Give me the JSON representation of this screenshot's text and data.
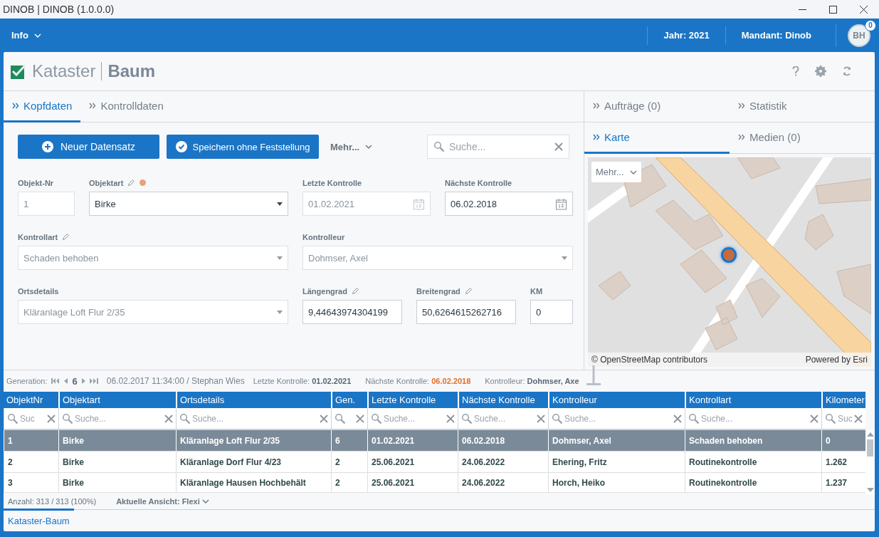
{
  "window": {
    "title": "DINOB | DINOB (1.0.0.0)"
  },
  "header": {
    "menu": "Info",
    "year": "Jahr: 2021",
    "client": "Mandant: Dinob",
    "avatar": "BH",
    "badge": "0"
  },
  "page": {
    "title": "Kataster",
    "subtitle": "Baum"
  },
  "left_tabs": [
    {
      "label": "Kopfdaten",
      "selected": true
    },
    {
      "label": "Kontrolldaten",
      "selected": false
    }
  ],
  "toolbar": {
    "buttons": [
      {
        "label": "Neuer Datensatz",
        "kind": "add"
      },
      {
        "label": "Speichern ohne Feststellung",
        "kind": "save"
      }
    ],
    "more": "Mehr...",
    "search": {
      "placeholder": "Suche..."
    }
  },
  "form": {
    "fields": [
      {
        "label": "Objekt-Nr",
        "kind": "text",
        "value": "1",
        "disabled": true,
        "editable": false
      },
      {
        "label": "Objektart",
        "kind": "select",
        "value": "Birke",
        "disabled": false,
        "editable": true,
        "color": "#e8a27c"
      },
      {
        "label": "Letzte Kontrolle",
        "kind": "date",
        "value": "01.02.2021",
        "disabled": true,
        "editable": false
      },
      {
        "label": "Nächste Kontrolle",
        "kind": "date",
        "value": "06.02.2018",
        "disabled": false,
        "editable": false
      },
      {
        "label": "Kontrollart",
        "kind": "select",
        "value": "Schaden behoben",
        "disabled": true,
        "editable": true
      },
      {
        "label": "Kontrolleur",
        "kind": "select",
        "value": "Dohmser, Axel",
        "disabled": true,
        "editable": false
      },
      {
        "label": "Ortsdetails",
        "kind": "select",
        "value": "Kläranlage Loft  Flur 2/35",
        "disabled": true,
        "editable": false
      },
      {
        "label": "Längengrad",
        "kind": "text",
        "value": "9,44643974304199",
        "disabled": false,
        "editable": true
      },
      {
        "label": "Breitengrad",
        "kind": "text",
        "value": "50,6264615262716",
        "disabled": false,
        "editable": true
      },
      {
        "label": "KM",
        "kind": "text",
        "value": "0",
        "disabled": false,
        "editable": false
      }
    ]
  },
  "panel_tabs": [
    {
      "label": "Aufträge (0)",
      "selected": false
    },
    {
      "label": "Statistik",
      "selected": false
    }
  ],
  "view_tabs": [
    {
      "label": "Karte",
      "selected": true
    },
    {
      "label": "Medien (0)",
      "selected": false
    }
  ],
  "map": {
    "more": "Mehr...",
    "attribution": "© OpenStreetMap contributors",
    "powered": "Powered by Esri"
  },
  "generation": {
    "label": "Generation:",
    "number": "6",
    "info": "06.02.2017 11:34:00 / Stephan Wies",
    "details": [
      {
        "label": "Letzte Kontrolle:",
        "value": "01.02.2021",
        "color": "#5a6775"
      },
      {
        "label": "Nächste Kontrolle:",
        "value": "06.02.2018",
        "color": "#e0702a"
      },
      {
        "label": "Kontrolleur:",
        "value": "Dohmser, Axe",
        "color": "#5a6775"
      }
    ]
  },
  "table": {
    "columns": [
      {
        "title": "ObjektNr",
        "placeholder": "Suc"
      },
      {
        "title": "Objektart",
        "placeholder": "Suche..."
      },
      {
        "title": "Ortsdetails",
        "placeholder": "Suche..."
      },
      {
        "title": "Gen."
      },
      {
        "title": "Letzte Kontrolle",
        "placeholder": "Suche..."
      },
      {
        "title": "Nächste Kontrolle",
        "placeholder": "Suche..."
      },
      {
        "title": "Kontrolleur",
        "placeholder": "Suche..."
      },
      {
        "title": "Kontrollart",
        "placeholder": "Suche..."
      },
      {
        "title": "Kilometer",
        "placeholder": "Suc"
      }
    ],
    "rows": [
      {
        "selected": true,
        "cells": [
          "1",
          "Birke",
          "Kläranlage Loft  Flur 2/35",
          "6",
          "01.02.2021",
          "06.02.2018",
          "Dohmser, Axel",
          "Schaden behoben",
          "0"
        ]
      },
      {
        "selected": false,
        "cells": [
          "2",
          "Birke",
          "Kläranlage Dorf  Flur 4/23",
          "2",
          "25.06.2021",
          "24.06.2022",
          "Ehering, Fritz",
          "Routinekontrolle",
          "1.262"
        ]
      },
      {
        "selected": false,
        "cells": [
          "3",
          "Birke",
          "Kläranlage Hausen  Hochbehält",
          "2",
          "25.06.2021",
          "24.06.2022",
          "Horch, Heiko",
          "Routinekontrolle",
          "1.237"
        ]
      }
    ]
  },
  "footer": {
    "count": "Anzahl: 313 / 313 (100%)",
    "view": "Aktuelle Ansicht: Flexi"
  },
  "bottom_tabs": [
    {
      "label": "Kataster-Baum",
      "selected": true
    }
  ]
}
